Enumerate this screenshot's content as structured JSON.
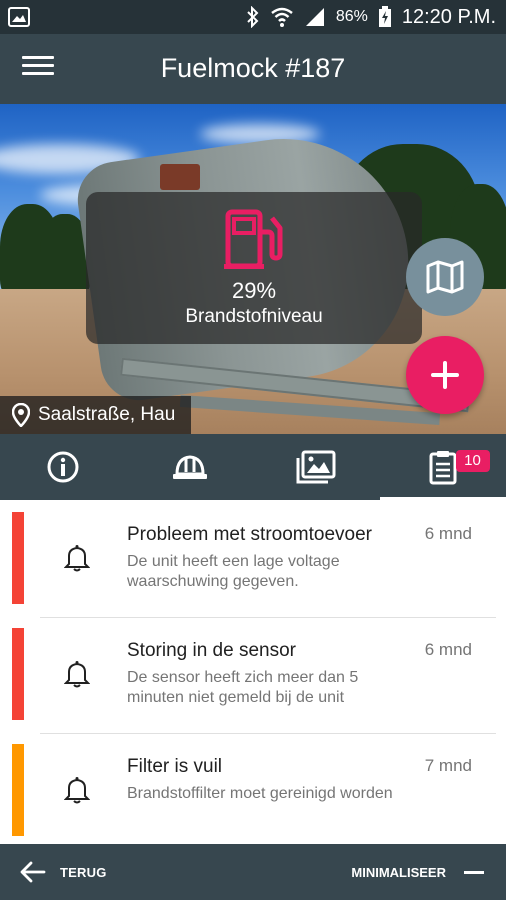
{
  "status_bar": {
    "battery": "86%",
    "time": "12:20 P.M."
  },
  "app_bar": {
    "title": "Fuelmock #187"
  },
  "hero": {
    "gauge": {
      "percent": "29%",
      "label": "Brandstofniveau",
      "icon": "fuel-pump-icon"
    },
    "location": "Saalstraße, Hau",
    "colors": {
      "accent": "#e91e63",
      "map_fab": "#78909c"
    }
  },
  "tabs": [
    {
      "icon": "info-icon"
    },
    {
      "icon": "hard-hat-icon"
    },
    {
      "icon": "gallery-icon"
    },
    {
      "icon": "clipboard-icon",
      "badge": "10",
      "active": true
    }
  ],
  "notifications": [
    {
      "title": "Probleem met stroomtoevoer",
      "description": "De unit heeft een lage voltage waarschuwing gegeven.",
      "time": "6 mnd",
      "color": "#f44336"
    },
    {
      "title": "Storing in de sensor",
      "description": "De sensor heeft zich meer dan 5 minuten niet gemeld bij de unit",
      "time": "6 mnd",
      "color": "#f44336"
    },
    {
      "title": "Filter is vuil",
      "description": "Brandstoffilter moet gereinigd worden",
      "time": "7 mnd",
      "color": "#ff9800"
    }
  ],
  "bottom_bar": {
    "back_label": "TERUG",
    "minimize_label": "MINIMALISEER"
  }
}
